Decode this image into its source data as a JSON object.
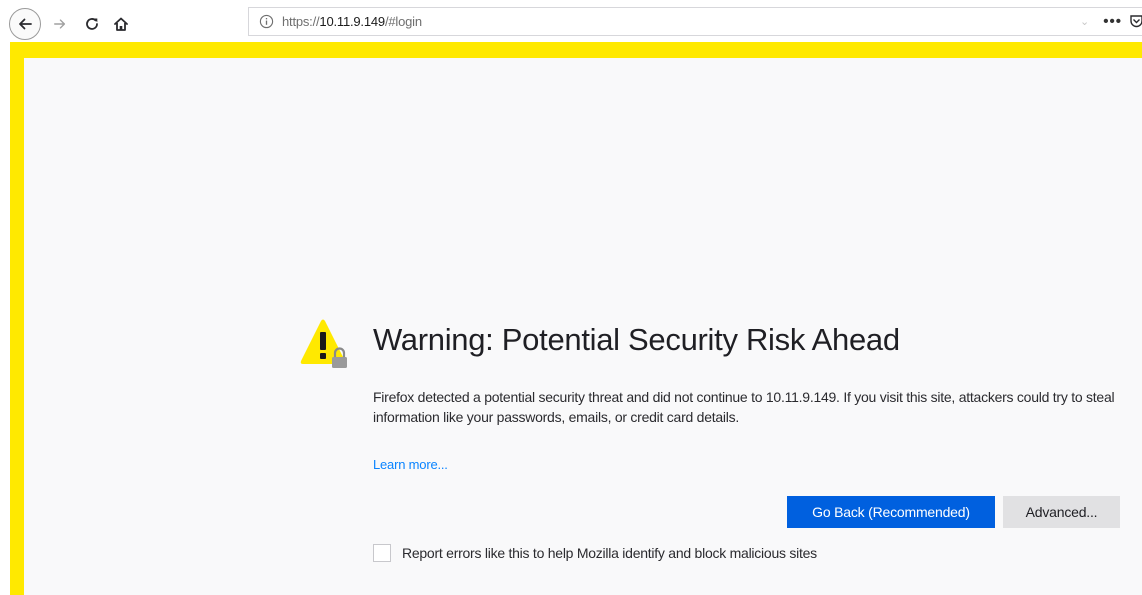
{
  "browser": {
    "url_scheme": "https://",
    "url_host": "10.11.9.149",
    "url_path": "/#login",
    "more_menu": "•••",
    "icons": [
      "back-arrow-icon",
      "forward-arrow-icon",
      "reload-icon",
      "home-icon",
      "info-icon",
      "chevron-down-icon",
      "more-icon",
      "pocket-icon"
    ]
  },
  "warning": {
    "title": "Warning: Potential Security Risk Ahead",
    "description": "Firefox detected a potential security threat and did not continue to 10.11.9.149. If you visit this site, attackers could try to steal information like your passwords, emails, or credit card details.",
    "learn_more": "Learn more...",
    "go_back_label": "Go Back (Recommended)",
    "advanced_label": "Advanced...",
    "report_label": "Report errors like this to help Mozilla identify and block malicious sites",
    "report_checked": false,
    "icon": "warning-lock-icon"
  },
  "colors": {
    "frame": "#ffe900",
    "background": "#f9f9fa",
    "primary_button": "#0060df",
    "secondary_button": "#e1e1e3",
    "link": "#0a84ff",
    "warning_icon": "#ffe900"
  }
}
